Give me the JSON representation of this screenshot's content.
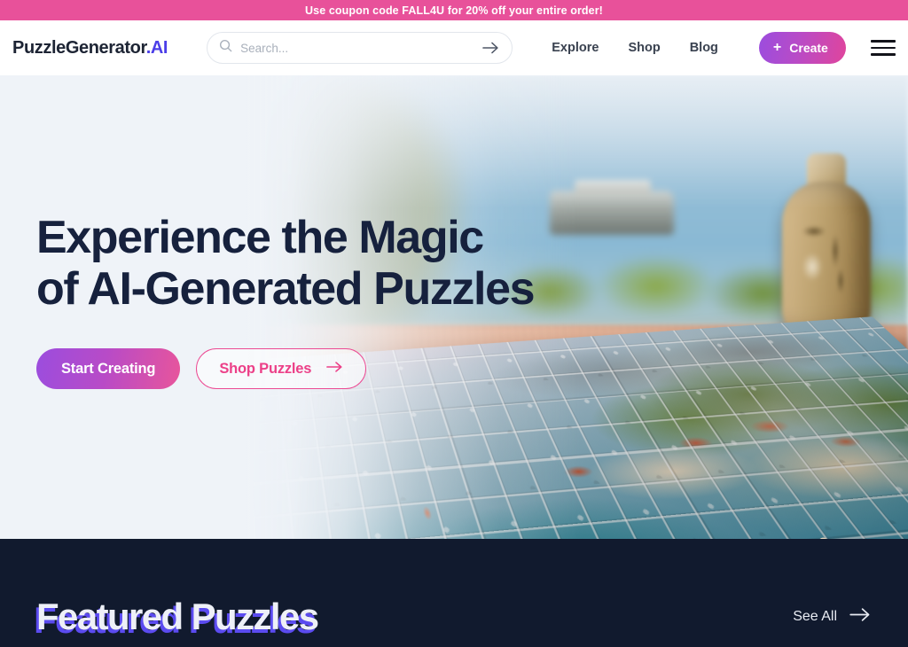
{
  "promo": {
    "text": "Use coupon code FALL4U for 20% off your entire order!",
    "bg_color": "#e8519a"
  },
  "header": {
    "logo_main": "PuzzleGenerator",
    "logo_accent": ".AI",
    "logo_accent_color": "#4b3ee8",
    "search": {
      "placeholder": "Search...",
      "value": "",
      "icon": "search-icon",
      "submit_icon": "arrow-right-icon"
    },
    "nav": [
      {
        "label": "Explore"
      },
      {
        "label": "Shop"
      },
      {
        "label": "Blog"
      }
    ],
    "create_button": {
      "label": "Create",
      "icon": "plus-icon",
      "gradient_from": "#9b4dde",
      "gradient_to": "#e0459c"
    },
    "menu_icon": "hamburger-menu-icon"
  },
  "hero": {
    "title": "Experience the Magic\nof AI-Generated Puzzles",
    "title_color": "#16213d",
    "background_color": "#eff3f8",
    "primary_cta": {
      "label": "Start Creating",
      "gradient_from": "#9b4dde",
      "gradient_to": "#e8559b"
    },
    "secondary_cta": {
      "label": "Shop Puzzles",
      "icon": "arrow-right-icon",
      "color": "#ec4088",
      "border_color": "#ec4a93"
    },
    "image_alt": "Coastal town jigsaw puzzle partially assembled on a wooden table with a ceramic vase and loose puzzle pieces"
  },
  "featured": {
    "title": "Featured Puzzles",
    "title_color": "#eef0f7",
    "title_shadow_color": "#5b4bf0",
    "background_color": "#111a2e",
    "see_all": {
      "label": "See All",
      "icon": "arrow-right-icon"
    }
  }
}
